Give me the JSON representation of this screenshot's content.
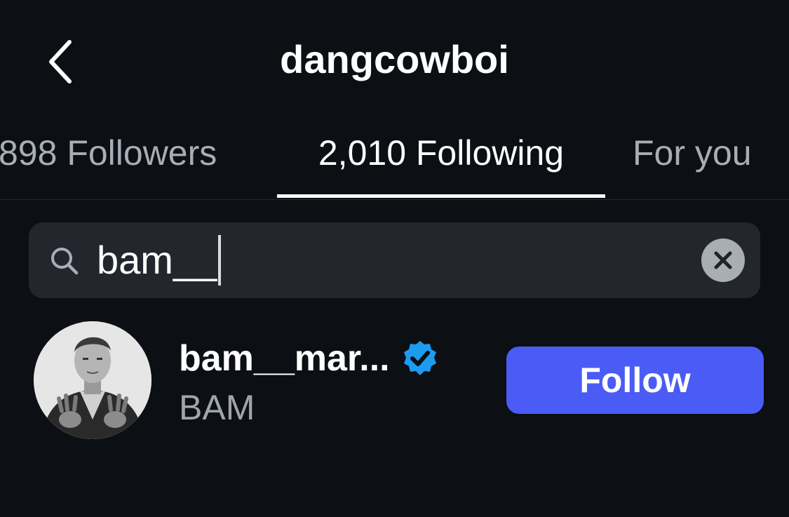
{
  "header": {
    "title": "dangcowboi",
    "back_icon": "chevron-left-icon"
  },
  "tabs": [
    {
      "label": "898 Followers",
      "active": false
    },
    {
      "label": "2,010 Following",
      "active": true
    },
    {
      "label": "For you",
      "active": false
    }
  ],
  "search": {
    "value": "bam__",
    "search_icon": "search-icon",
    "clear_icon": "close-circle-icon"
  },
  "results": [
    {
      "username": "bam__mar...",
      "verified": true,
      "full_name": "BAM",
      "avatar_icon": "avatar-photo",
      "follow_label": "Follow"
    }
  ],
  "colors": {
    "background": "#0c0f14",
    "search_bg": "#23262d",
    "follow_button": "#4a5cf5",
    "verified_badge": "#1d9bf0",
    "inactive_tab": "#a8adb6"
  }
}
